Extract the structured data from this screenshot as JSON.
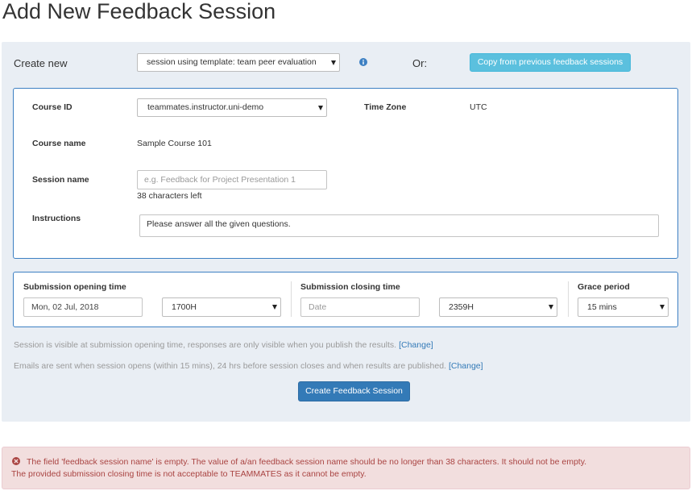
{
  "page": {
    "title": "Add New Feedback Session"
  },
  "colors": {
    "panel_bg": "#e9eef4",
    "panel_border": "#3d80c3",
    "primary": "#337ab7",
    "info": "#5bc0de",
    "link": "#337ab7",
    "muted_text": "#9a9a9a",
    "danger_text": "#a94442",
    "danger_bg": "#f2dede",
    "danger_border": "#ebccd1"
  },
  "create_row": {
    "label": "Create new",
    "template_select": {
      "selected": "session using template: team peer evaluation"
    },
    "help_icon": "info-circle-icon",
    "or_label": "Or:",
    "copy_button": "Copy from previous feedback sessions"
  },
  "details": {
    "course_id": {
      "label": "Course ID",
      "selected": "teammates.instructor.uni-demo"
    },
    "time_zone": {
      "label": "Time Zone",
      "value": "UTC"
    },
    "course_name": {
      "label": "Course name",
      "value": "Sample Course 101"
    },
    "session_name": {
      "label": "Session name",
      "placeholder": "e.g. Feedback for Project Presentation 1",
      "chars_left": "38 characters left"
    },
    "instructions": {
      "label": "Instructions",
      "value": "Please answer all the given questions."
    }
  },
  "schedule": {
    "opening": {
      "label": "Submission opening time",
      "date": "Mon, 02 Jul, 2018",
      "time": "1700H"
    },
    "closing": {
      "label": "Submission closing time",
      "date_placeholder": "Date",
      "time": "2359H"
    },
    "grace_period": {
      "label": "Grace period",
      "selected": "15 mins"
    }
  },
  "notes": {
    "visibility": {
      "text": "Session is visible at submission opening time, responses are only visible when you publish the results.",
      "link": "[Change]"
    },
    "emails": {
      "text": "Emails are sent when session opens (within 15 mins), 24 hrs before session closes and when results are published.",
      "link": "[Change]"
    }
  },
  "submit_button": "Create Feedback Session",
  "alert": {
    "icon": "remove-circle-icon",
    "messages": [
      "The field 'feedback session name' is empty. The value of a/an feedback session name should be no longer than 38 characters. It should not be empty.",
      "The provided submission closing time is not acceptable to TEAMMATES as it cannot be empty."
    ]
  }
}
